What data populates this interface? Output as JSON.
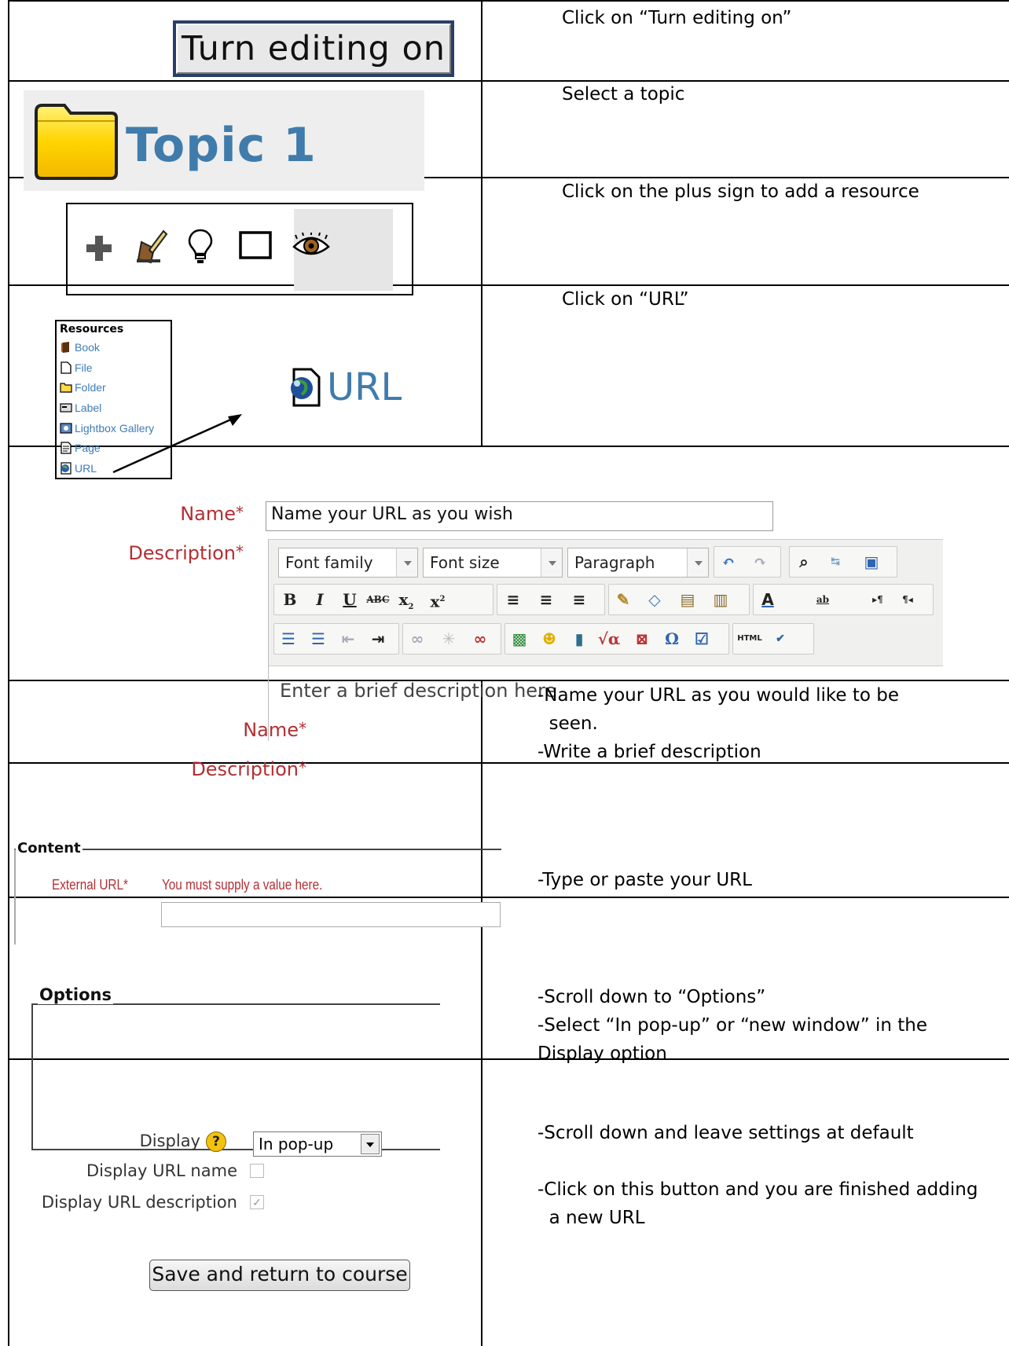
{
  "rows": [
    {
      "instructions": [
        "Click on “Turn editing on”"
      ]
    },
    {
      "instructions": [
        "Select a topic"
      ]
    },
    {
      "instructions": [
        "Click on the plus sign to add a resource"
      ]
    },
    {
      "instructions": [
        "Click on “URL”"
      ]
    },
    {
      "instructions": []
    },
    {
      "instructions": [
        "-Name your URL as you would like to be",
        "  seen.",
        "-Write a brief description"
      ]
    },
    {
      "instructions": [
        "-Type or paste your URL"
      ]
    },
    {
      "instructions": [
        "-Scroll down to “Options”",
        "-Select “In pop-up” or “new window” in the",
        "Display option"
      ]
    },
    {
      "instructions": [
        "-Scroll down and leave settings at default",
        "",
        "-Click on this button and you are finished adding",
        "  a new URL"
      ]
    }
  ],
  "turn_editing_button": "Turn editing on",
  "topic_label": "Topic 1",
  "toolbar_icons": [
    "plus-icon",
    "edit-icon",
    "lightbulb-icon",
    "square-icon",
    "eye-icon"
  ],
  "resources_menu": {
    "title": "Resources",
    "items": [
      {
        "label": "Book",
        "icon": "book-icon"
      },
      {
        "label": "File",
        "icon": "file-icon"
      },
      {
        "label": "Folder",
        "icon": "folder-icon"
      },
      {
        "label": "Label",
        "icon": "label-icon"
      },
      {
        "label": "Lightbox Gallery",
        "icon": "gallery-icon"
      },
      {
        "label": "Page",
        "icon": "page-icon"
      },
      {
        "label": "URL",
        "icon": "globe-icon"
      }
    ]
  },
  "url_label": "URL",
  "form": {
    "name_label": "Name",
    "description_label": "Description",
    "required_mark": "*",
    "name_value": "Name your URL as you wish",
    "font_family": "Font family",
    "font_size": "Font size",
    "paragraph": "Paragraph",
    "editor_text": "Enter a brief description here"
  },
  "content": {
    "legend": "Content",
    "external_url_label": "External URL",
    "required_mark": "*",
    "error_message": "You must supply a value here."
  },
  "options": {
    "legend": "Options",
    "display_label": "Display",
    "display_value": "In pop-up",
    "display_url_name_label": "Display URL name",
    "display_url_name_checked": false,
    "display_url_description_label": "Display URL description",
    "display_url_description_checked": true
  },
  "save_button": "Save and return to course",
  "colors": {
    "link_blue": "#3e7cb6",
    "required_red": "#b32f34",
    "topic_blue": "#3f7cac"
  }
}
